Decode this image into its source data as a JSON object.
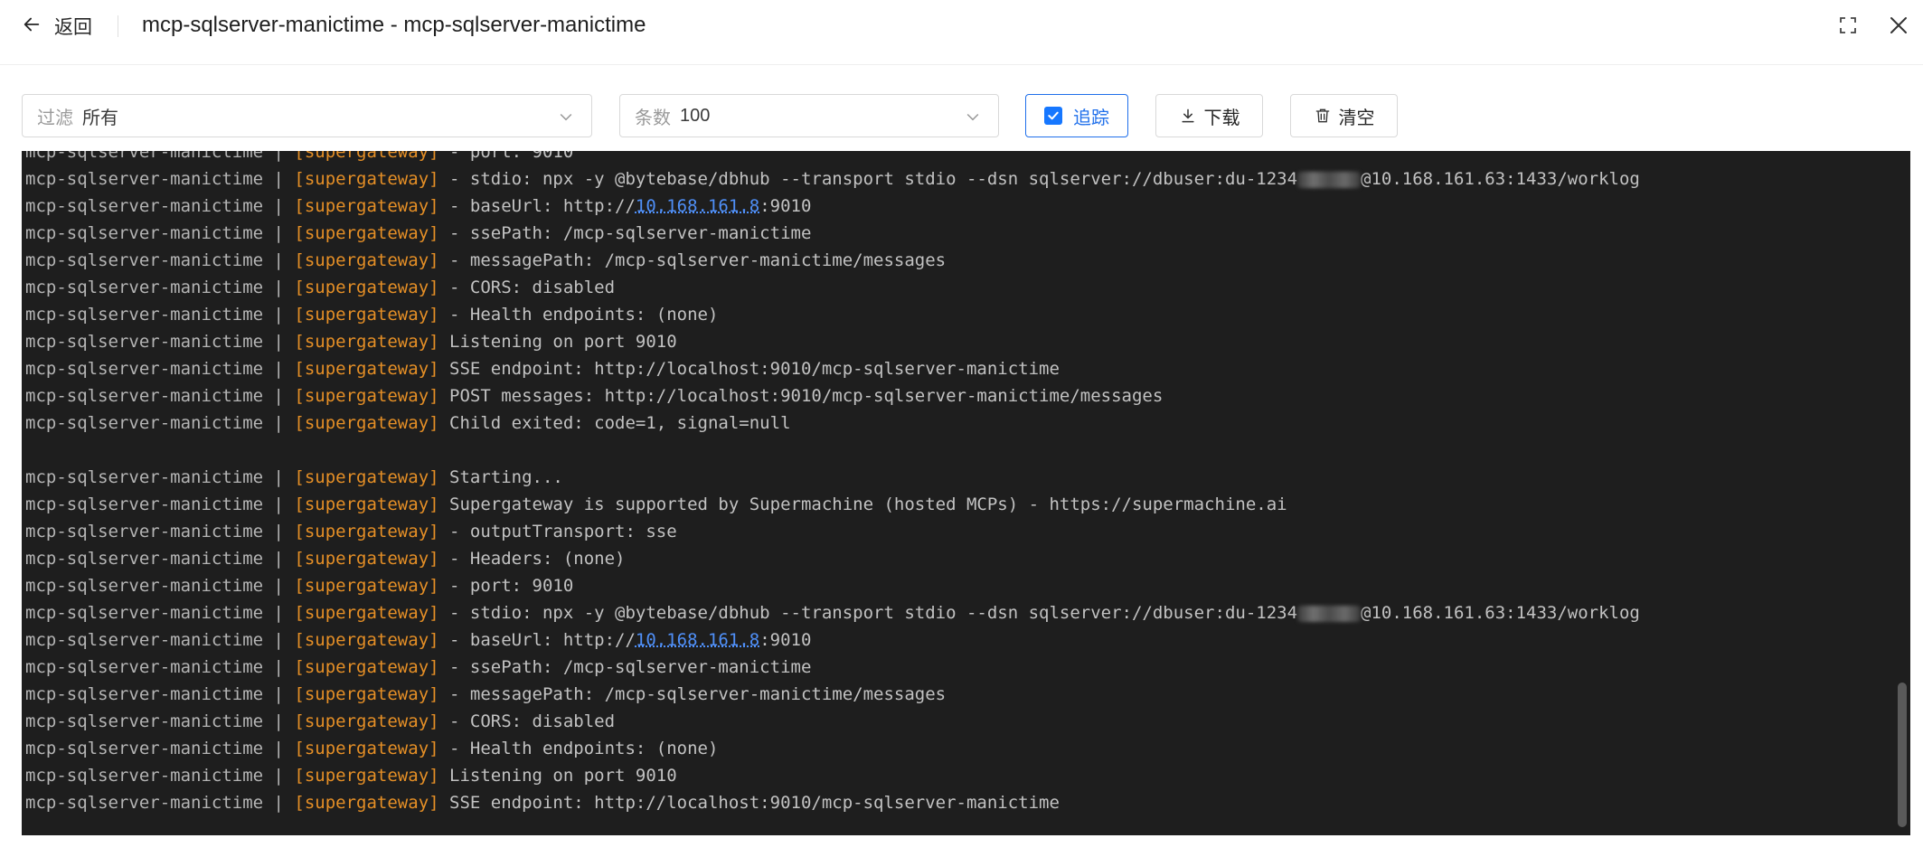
{
  "header": {
    "back_label": "返回",
    "title": "mcp-sqlserver-manictime - mcp-sqlserver-manictime"
  },
  "toolbar": {
    "filter": {
      "prefix": "过滤",
      "value": "所有"
    },
    "count": {
      "prefix": "条数",
      "value": "100"
    },
    "trace_label": "追踪",
    "download_label": "下载",
    "clear_label": "清空"
  },
  "log": {
    "service": "mcp-sqlserver-manictime",
    "separator": " | ",
    "tag": "[supergateway]",
    "lines": [
      {
        "msg": " - port: 9010"
      },
      {
        "msg": " - stdio: npx -y @bytebase/dbhub --transport stdio --dsn sqlserver://dbuser:du-1234",
        "blur": true,
        "msg_after": "@10.168.161.63:1433/worklog"
      },
      {
        "msg": " - baseUrl: http://",
        "ip": "10.168.161.8",
        "msg_after": ":9010"
      },
      {
        "msg": " - ssePath: /mcp-sqlserver-manictime"
      },
      {
        "msg": " - messagePath: /mcp-sqlserver-manictime/messages"
      },
      {
        "msg": " - CORS: disabled"
      },
      {
        "msg": " - Health endpoints: (none)"
      },
      {
        "msg": " Listening on port 9010"
      },
      {
        "msg": " SSE endpoint: http://localhost:9010/mcp-sqlserver-manictime"
      },
      {
        "msg": " POST messages: http://localhost:9010/mcp-sqlserver-manictime/messages"
      },
      {
        "msg": " Child exited: code=1, signal=null"
      },
      {
        "empty": true
      },
      {
        "msg": " Starting..."
      },
      {
        "msg": " Supergateway is supported by Supermachine (hosted MCPs) - https://supermachine.ai"
      },
      {
        "msg": " - outputTransport: sse"
      },
      {
        "msg": " - Headers: (none)"
      },
      {
        "msg": " - port: 9010"
      },
      {
        "msg": " - stdio: npx -y @bytebase/dbhub --transport stdio --dsn sqlserver://dbuser:du-1234",
        "blur": true,
        "msg_after": "@10.168.161.63:1433/worklog"
      },
      {
        "msg": " - baseUrl: http://",
        "ip": "10.168.161.8",
        "msg_after": ":9010"
      },
      {
        "msg": " - ssePath: /mcp-sqlserver-manictime"
      },
      {
        "msg": " - messagePath: /mcp-sqlserver-manictime/messages"
      },
      {
        "msg": " - CORS: disabled"
      },
      {
        "msg": " - Health endpoints: (none)"
      },
      {
        "msg": " Listening on port 9010"
      },
      {
        "msg": " SSE endpoint: http://localhost:9010/mcp-sqlserver-manictime"
      }
    ]
  },
  "colors": {
    "tag": "#e58f26",
    "accent": "#1677ff",
    "log_bg": "#1e1e1e",
    "link": "#4f8ff7"
  },
  "icons": {
    "back": "arrow-left-icon",
    "fullscreen": "expand-icon",
    "close": "close-icon",
    "chevron": "chevron-down-icon",
    "check": "check-icon",
    "download": "download-icon",
    "clear": "trash-icon"
  }
}
